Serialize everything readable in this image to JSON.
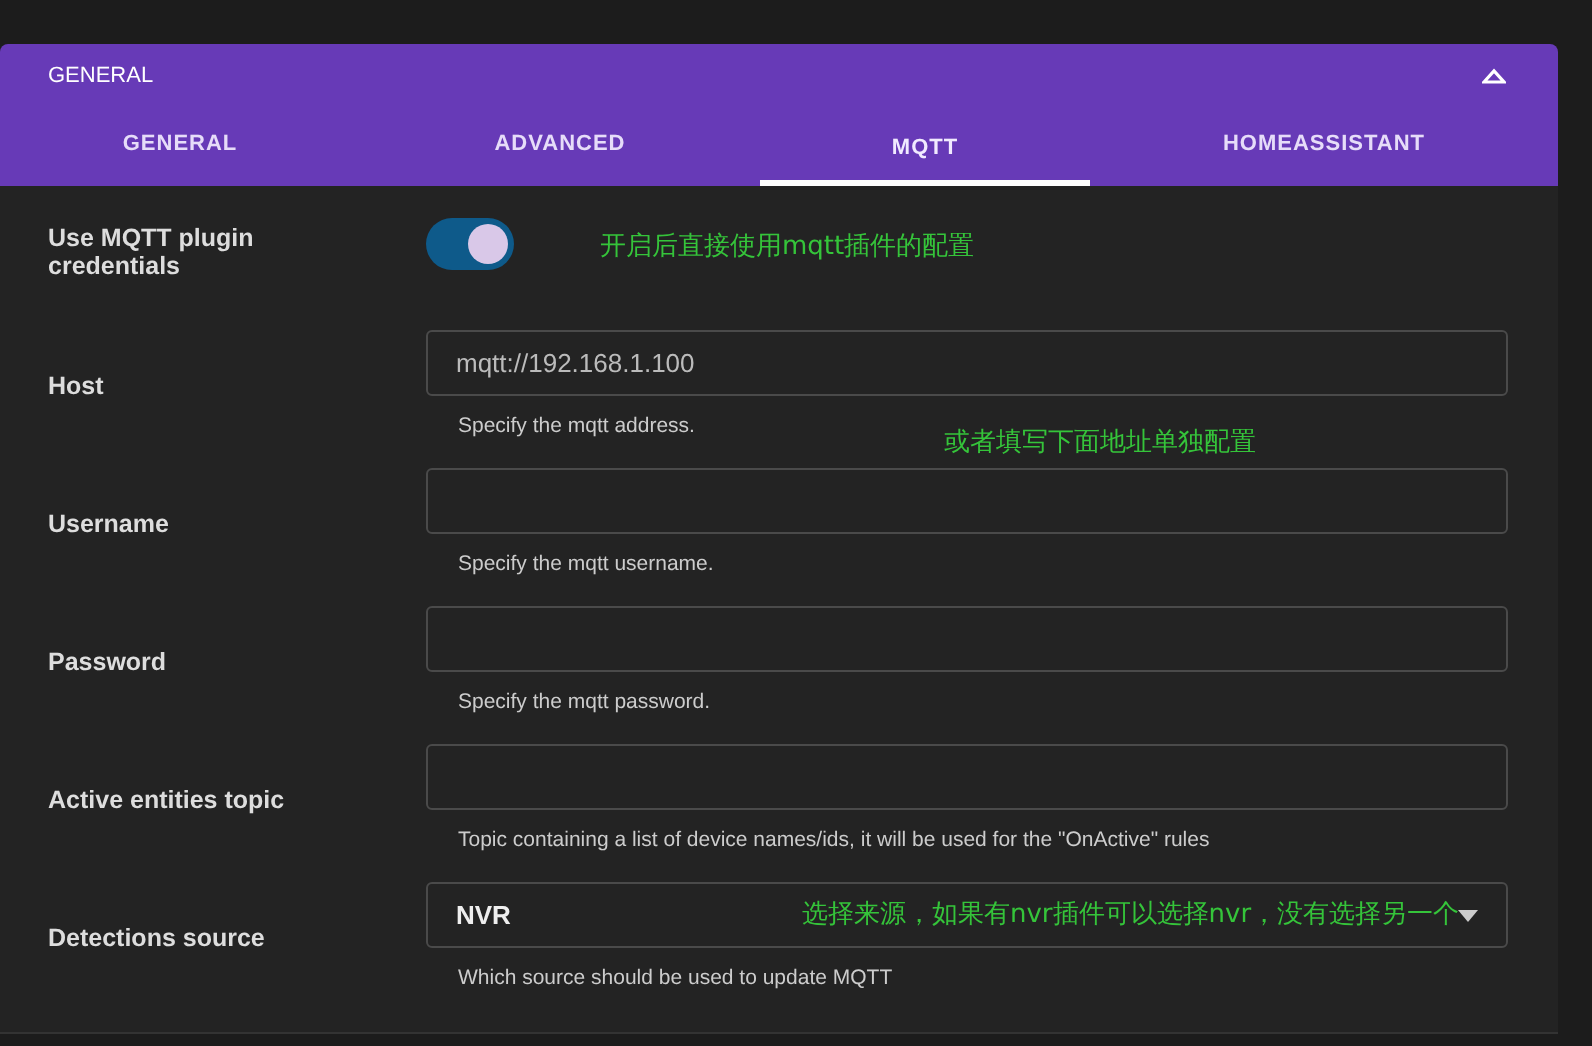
{
  "panel": {
    "title": "GENERAL",
    "expanded": true
  },
  "tabs": [
    {
      "label": "GENERAL",
      "selected": false
    },
    {
      "label": "ADVANCED",
      "selected": false
    },
    {
      "label": "MQTT",
      "selected": true
    },
    {
      "label": "HOMEASSISTANT",
      "selected": false
    }
  ],
  "fields": [
    {
      "kind": "toggle",
      "label": "Use MQTT plugin credentials",
      "on": true,
      "annotation": "开启后直接使用mqtt插件的配置"
    },
    {
      "kind": "text",
      "label": "Host",
      "value": "mqtt://192.168.1.100",
      "helper": "Specify the mqtt address.",
      "annotation": "或者填写下面地址单独配置"
    },
    {
      "kind": "text",
      "label": "Username",
      "helper": "Specify the mqtt username."
    },
    {
      "kind": "text",
      "label": "Password",
      "helper": "Specify the mqtt password."
    },
    {
      "kind": "text",
      "label": "Active entities topic",
      "helper": "Topic containing a list of device names/ids, it will be used for the \"OnActive\" rules"
    },
    {
      "kind": "select",
      "label": "Detections source",
      "value": "NVR",
      "helper": "Which source should be used to update MQTT",
      "annotation": "选择来源，如果有nvr插件可以选择nvr，没有选择另一个"
    }
  ]
}
